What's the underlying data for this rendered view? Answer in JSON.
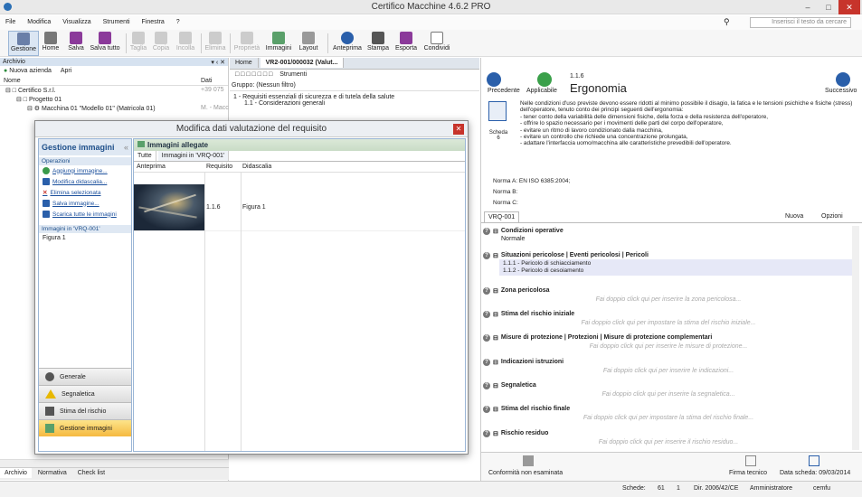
{
  "window": {
    "title": "Certifico Macchine 4.6.2 PRO"
  },
  "menu": [
    "File",
    "Modifica",
    "Visualizza",
    "Strumenti",
    "Finestra",
    "?"
  ],
  "search": {
    "placeholder": "Inserisci il testo da cercare"
  },
  "toolbar": [
    "Gestione",
    "Home",
    "Salva",
    "Salva tutto",
    "Taglia",
    "Copia",
    "Incolla",
    "Elimina",
    "Proprietà",
    "Immagini",
    "Layout",
    "Anteprima",
    "Stampa",
    "Esporta",
    "Condividi"
  ],
  "left": {
    "panel_title": "Archivio",
    "new_company": "Nuova azienda",
    "open": "Apri",
    "col_name": "Nome",
    "col_data": "Dati",
    "tree": [
      {
        "label": "Certifico S.r.l.",
        "data": "+39 075"
      },
      {
        "label": "Progetto 01",
        "data": ""
      },
      {
        "label": "Macchina 01 \"Modello 01\" (Matricola 01)",
        "data": "M. - Macc"
      }
    ],
    "bottom_tabs": [
      "Archivio",
      "Normativa",
      "Check list"
    ]
  },
  "center": {
    "tabs": [
      "Home",
      "VR2-001/000032 (Valut..."
    ],
    "tools": "Strumenti",
    "group": "Gruppo: (Nessun filtro)",
    "tree": [
      "1 - Requisiti essenziali di sicurezza e di tutela della salute",
      "1.1 - Considerazioni generali"
    ]
  },
  "right": {
    "nav": {
      "prev": "Precedente",
      "applicable": "Applicabile",
      "next": "Successivo",
      "code": "1.1.6",
      "title": "Ergonomia"
    },
    "scheda": {
      "label": "Scheda",
      "num": "6"
    },
    "description": [
      "Nelle condizioni d'uso previste devono essere ridotti al minimo possibile il disagio, la fatica e le tensioni psichiche e fisiche (stress)",
      "dell'operatore, tenuto conto dei principi seguenti dell'ergonomia:",
      "- tener conto della variabilità delle dimensioni fisiche, della forza e della resistenza dell'operatore,",
      "- offrire lo spazio necessario per i movimenti delle parti del corpo dell'operatore,",
      "- evitare un ritmo di lavoro condizionato dalla macchina,",
      "- evitare un controllo che richiede una concentrazione prolungata,",
      "- adattare l'interfaccia uomo/macchina alle caratteristiche prevedibili dell'operatore."
    ],
    "norms": [
      "Norma A: EN ISO 6385:2004;",
      "Norma B:",
      "Norma C:"
    ],
    "tab": "VRQ-001",
    "new": "Nuova",
    "options": "Opzioni",
    "sections": [
      {
        "title": "Condizioni operative",
        "value": "Normale",
        "hint": ""
      },
      {
        "title": "Situazioni pericolose | Eventi pericolosi | Pericoli",
        "value": "",
        "hint": "",
        "items": [
          "1.1.1 - Pericolo di schiacciamento",
          "1.1.2 - Pericolo di cesoiamento"
        ]
      },
      {
        "title": "Zona pericolosa",
        "value": "",
        "hint": "Fai doppio click qui per inserire la zona pericolosa..."
      },
      {
        "title": "Stima del rischio iniziale",
        "value": "",
        "hint": "Fai doppio click qui per impostare la stima del rischio iniziale..."
      },
      {
        "title": "Misure di protezione | Protezioni | Misure di protezione complementari",
        "value": "",
        "hint": "Fai doppio click qui per inserire le misure di protezione..."
      },
      {
        "title": "Indicazioni istruzioni",
        "value": "",
        "hint": "Fai doppio click qui per inserire le indicazioni..."
      },
      {
        "title": "Segnaletica",
        "value": "",
        "hint": "Fai doppio click qui per inserire la segnaletica..."
      },
      {
        "title": "Stima del rischio finale",
        "value": "",
        "hint": "Fai doppio click qui per impostare la stima del rischio finale..."
      },
      {
        "title": "Rischio residuo",
        "value": "",
        "hint": "Fai doppio click qui per inserire il rischio residuo..."
      }
    ],
    "footer": {
      "conformity": "Conformità non esaminata",
      "sign": "Firma tecnico",
      "date": "Data scheda: 09/03/2014"
    }
  },
  "status": {
    "schede": "Schede:",
    "count1": "61",
    "count2": "1",
    "dir": "Dir. 2006/42/CE",
    "user": "Amministratore",
    "account": "cemfu"
  },
  "modal": {
    "title": "Modifica dati valutazione del requisito",
    "side_title": "Gestione immagini",
    "ops_title": "Operazioni",
    "ops": [
      "Aggiungi immagine...",
      "Modifica didascalia...",
      "Elimina selezionata",
      "Salva immagine...",
      "Scarica tutte le immagini"
    ],
    "images_in": "Immagini in 'VRQ-001'",
    "images_list": [
      "Figura 1"
    ],
    "nav": [
      "Generale",
      "Segnaletica",
      "Stima del rischio",
      "Gestione immagini"
    ],
    "panel_title": "Immagini allegate",
    "tabs": [
      "Tutte",
      "Immagini in 'VRQ-001'"
    ],
    "cols": [
      "Anteprima",
      "Requisito",
      "Didascalia"
    ],
    "row": {
      "req": "1.1.6",
      "caption": "Figura 1"
    }
  }
}
